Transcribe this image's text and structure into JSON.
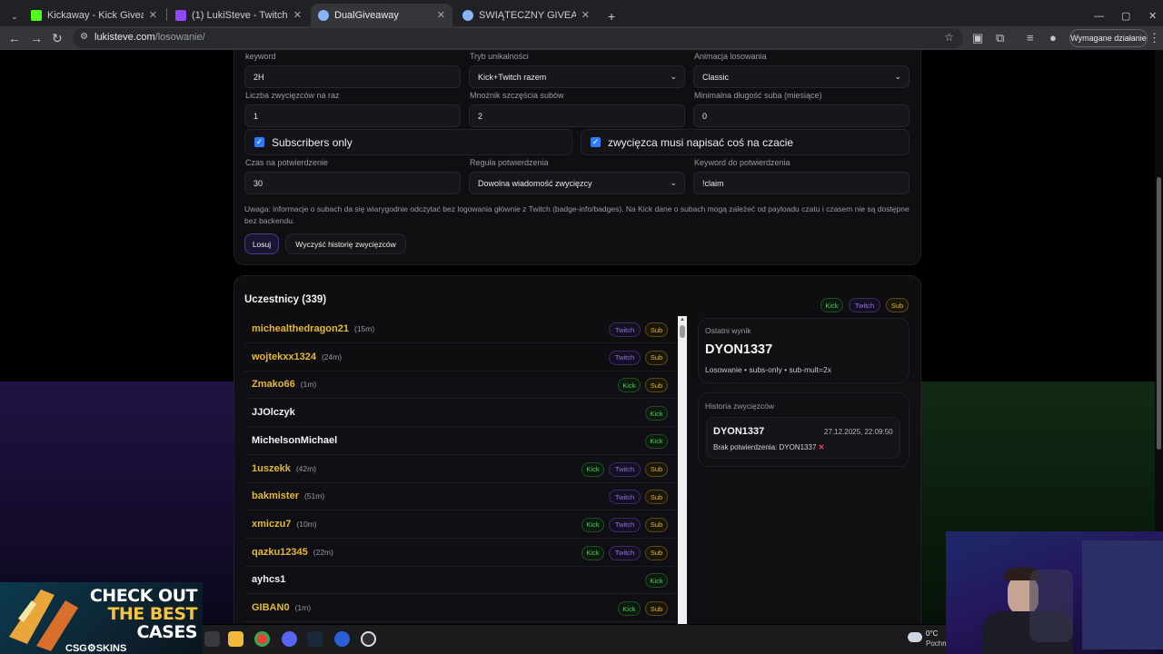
{
  "browser": {
    "tabs": [
      {
        "label": "Kickaway - Kick Giveaway Tool",
        "color": "#53fc18"
      },
      {
        "label": "(1) LukiSteve - Twitch",
        "color": "#9146ff"
      },
      {
        "label": "DualGiveaway",
        "color": "#8ab4f8",
        "active": true
      },
      {
        "label": "ŚWIĄTECZNY GIVEAWAY",
        "color": "#8ab4f8"
      }
    ],
    "url_host": "lukisteve.com",
    "url_path": "/losowanie/",
    "action_label": "Wymagane działanie"
  },
  "settings": {
    "keyword": {
      "label": "keyword",
      "value": "2H"
    },
    "uniqueness": {
      "label": "Tryb unikalności",
      "value": "Kick+Twitch razem"
    },
    "animation": {
      "label": "Animacja losowania",
      "value": "Classic"
    },
    "winners": {
      "label": "Liczba zwycięzców na raz",
      "value": "1"
    },
    "sub_luck": {
      "label": "Mnożnik szczęścia subów",
      "value": "2"
    },
    "min_sub": {
      "label": "Minimalna długość suba (miesiące)",
      "value": "0"
    },
    "subs_only": "Subscribers only",
    "must_write": "zwycięzca musi napisać coś na czacie",
    "confirm_time": {
      "label": "Czas na potwierdzenie",
      "value": "30"
    },
    "confirm_rule": {
      "label": "Reguła potwierdzenia",
      "value": "Dowolna wiadomość zwycięzcy"
    },
    "confirm_keyword": {
      "label": "Keyword do potwierdzenia",
      "value": "!claim"
    },
    "note": "Uwaga: informacje o subach da się wiarygodnie odczytać bez logowania głównie z Twitch (badge-info/badges). Na Kick dane o subach mogą zależeć od payloadu czatu i czasem nie są dostępne bez backendu.",
    "draw_button": "Losuj",
    "clear_button": "Wyczyść historię zwycięzców"
  },
  "participants": {
    "title": "Uczestnicy (339)",
    "legend": [
      "Kick",
      "Twitch",
      "Sub"
    ],
    "rows": [
      {
        "name": "michealthedragon21",
        "dur": "(15m)",
        "color": "#e5b92e",
        "tags": [
          "Twitch",
          "Sub"
        ]
      },
      {
        "name": "wojtekxx1324",
        "dur": "(24m)",
        "color": "#e5b92e",
        "tags": [
          "Twitch",
          "Sub"
        ]
      },
      {
        "name": "Zmako66",
        "dur": "(1m)",
        "color": "#e5b92e",
        "tags": [
          "Kick",
          "Sub"
        ]
      },
      {
        "name": "JJOlczyk",
        "dur": "",
        "color": "#f2f2f2",
        "tags": [
          "Kick"
        ]
      },
      {
        "name": "MichelsonMichael",
        "dur": "",
        "color": "#f2f2f2",
        "tags": [
          "Kick"
        ]
      },
      {
        "name": "1uszekk",
        "dur": "(42m)",
        "color": "#e5b92e",
        "tags": [
          "Kick",
          "Twitch",
          "Sub"
        ]
      },
      {
        "name": "bakmister",
        "dur": "(51m)",
        "color": "#e5b92e",
        "tags": [
          "Twitch",
          "Sub"
        ]
      },
      {
        "name": "xmiczu7",
        "dur": "(10m)",
        "color": "#e5b92e",
        "tags": [
          "Kick",
          "Twitch",
          "Sub"
        ]
      },
      {
        "name": "qazku12345",
        "dur": "(22m)",
        "color": "#e5b92e",
        "tags": [
          "Kick",
          "Twitch",
          "Sub"
        ]
      },
      {
        "name": "ayhcs1",
        "dur": "",
        "color": "#f2f2f2",
        "tags": [
          "Kick"
        ]
      },
      {
        "name": "GIBAN0",
        "dur": "(1m)",
        "color": "#e5b92e",
        "tags": [
          "Kick",
          "Sub"
        ]
      }
    ]
  },
  "result": {
    "label": "Ostatni wynik",
    "winner": "DYON1337",
    "meta": "Losowanie • subs-only • sub-mult=2x"
  },
  "history": {
    "label": "Historia zwycięzców",
    "entry_name": "DYON1337",
    "entry_date": "27.12.2025, 22:09:50",
    "entry_status": "Brak potwierdzenia: DYON1337"
  },
  "overlay": {
    "promo_line1": "CHECK OUT",
    "promo_line2": "THE BEST",
    "promo_line3": "CASES",
    "promo_brand": "CSG⚙SKINS",
    "weather_temp": "0°C",
    "weather_text": "Pochm"
  }
}
